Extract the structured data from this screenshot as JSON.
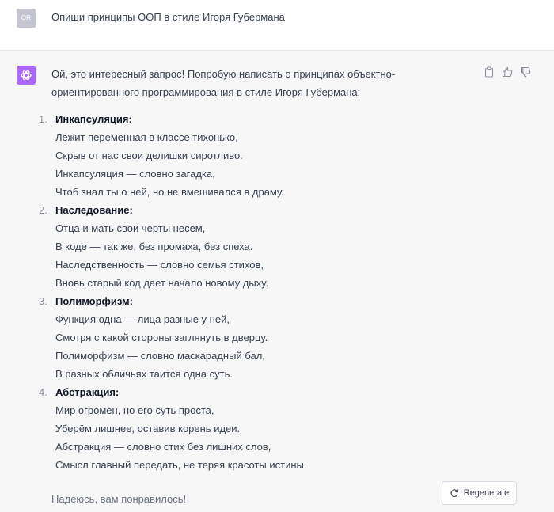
{
  "user": {
    "initials": "OR",
    "prompt": "Опиши принципы ООП в стиле Игоря Губермана"
  },
  "assistant": {
    "intro_1": "Ой, это интересный запрос! Попробую написать о принципах объектно-",
    "intro_2": "ориентированного программирования в стиле Игоря Губермана:",
    "items": [
      {
        "num": "1.",
        "title": "Инкапсуляция:",
        "lines": [
          "Лежит переменная в классе тихонько,",
          "Скрыв от нас свои делишки сиротливо.",
          "Инкапсуляция — словно загадка,",
          "Чтоб знал ты о ней, но не вмешивался в драму."
        ]
      },
      {
        "num": "2.",
        "title": "Наследование:",
        "lines": [
          "Отца и мать свои черты несем,",
          "В коде — так же, без промаха, без спеха.",
          "Наследственность — словно семья стихов,",
          "Вновь старый код дает начало новому дыху."
        ]
      },
      {
        "num": "3.",
        "title": "Полиморфизм:",
        "lines": [
          "Функция одна — лица разные у ней,",
          "Смотря с какой стороны заглянуть в дверцу.",
          "Полиморфизм — словно маскарадный бал,",
          "В разных обличьях таится одна суть."
        ]
      },
      {
        "num": "4.",
        "title": "Абстракция:",
        "lines": [
          "Мир огромен, но его суть проста,",
          "Уберём лишнее, оставив корень идеи.",
          "Абстракция — словно стих без лишних слов,",
          "Смысл главный передать, не теряя красоты истины."
        ]
      }
    ],
    "closing": "Надеюсь, вам понравилось!"
  },
  "actions": {
    "icons": [
      "clipboard-icon",
      "thumbs-up-icon",
      "thumbs-down-icon"
    ]
  },
  "regenerate": {
    "label": "Regenerate"
  },
  "colors": {
    "avatar_user": "#c5c5d2",
    "avatar_bot": "#ab68ff",
    "assistant_bg": "#f7f7f8"
  }
}
